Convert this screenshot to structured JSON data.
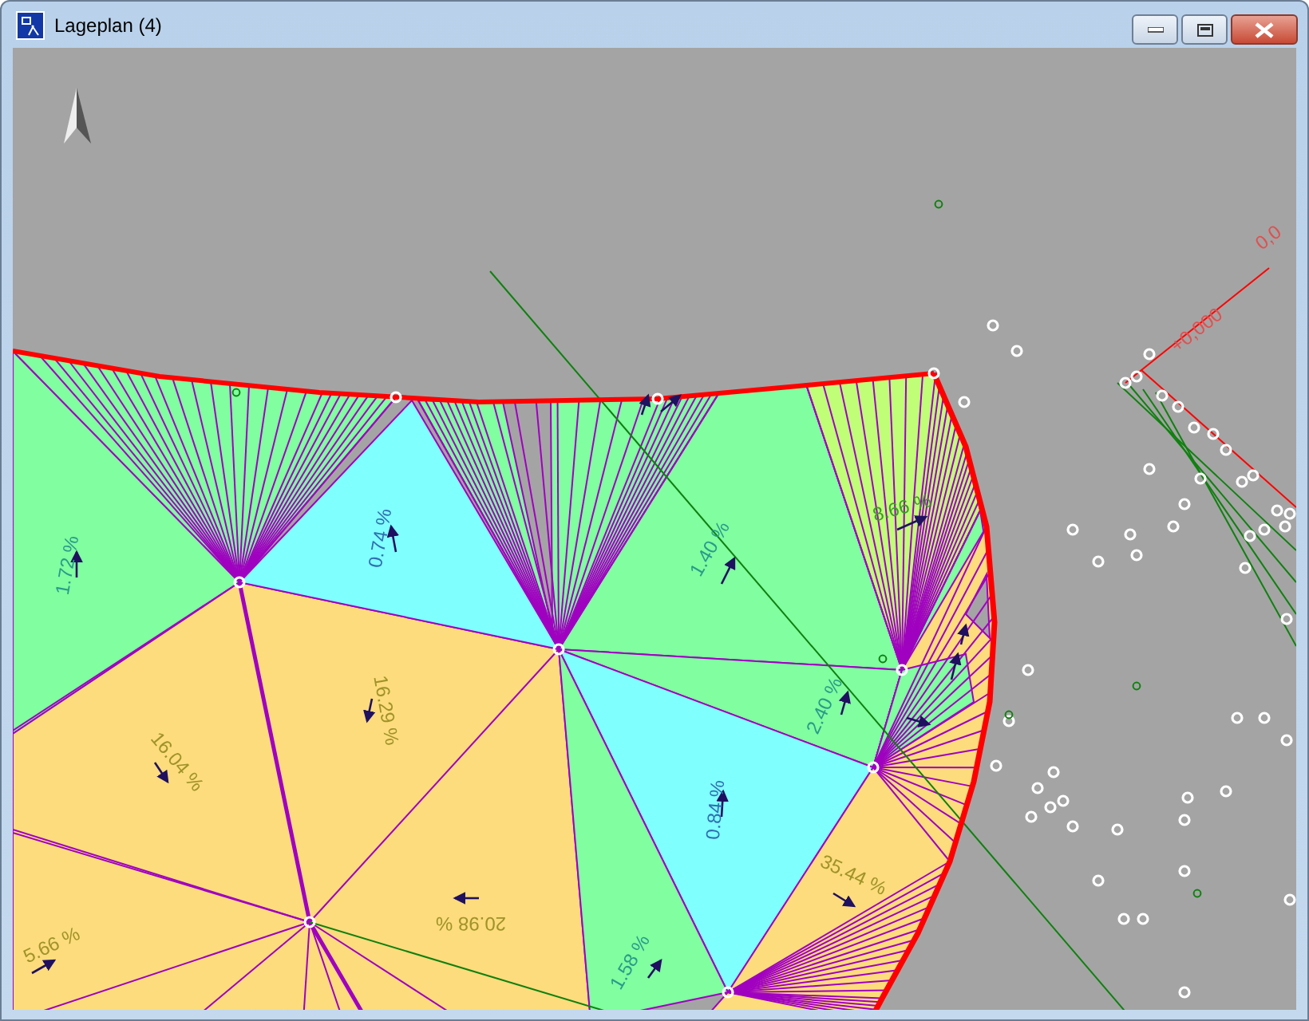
{
  "window": {
    "title": "Lageplan (4)"
  },
  "slope_labels": [
    {
      "text": "1.72 %",
      "color": "#2a9a8a"
    },
    {
      "text": "0.74 %",
      "color": "#2f6fb0"
    },
    {
      "text": "1.40 %",
      "color": "#2a9a8a"
    },
    {
      "text": "8.66 %",
      "color": "#3c9a2a"
    },
    {
      "text": "2.40 %",
      "color": "#2a9a8a"
    },
    {
      "text": "16.29 %",
      "color": "#a0922a"
    },
    {
      "text": "16.04 %",
      "color": "#a0922a"
    },
    {
      "text": "20.98 %",
      "color": "#a0922a"
    },
    {
      "text": "0.84 %",
      "color": "#2f6fb0"
    },
    {
      "text": "35.44 %",
      "color": "#a0922a"
    },
    {
      "text": "1.58 %",
      "color": "#2a9a8a"
    },
    {
      "text": "5.66 %",
      "color": "#a0922a"
    }
  ],
  "height_labels": [
    {
      "text": "+0,000"
    },
    {
      "text": "0,0"
    }
  ]
}
